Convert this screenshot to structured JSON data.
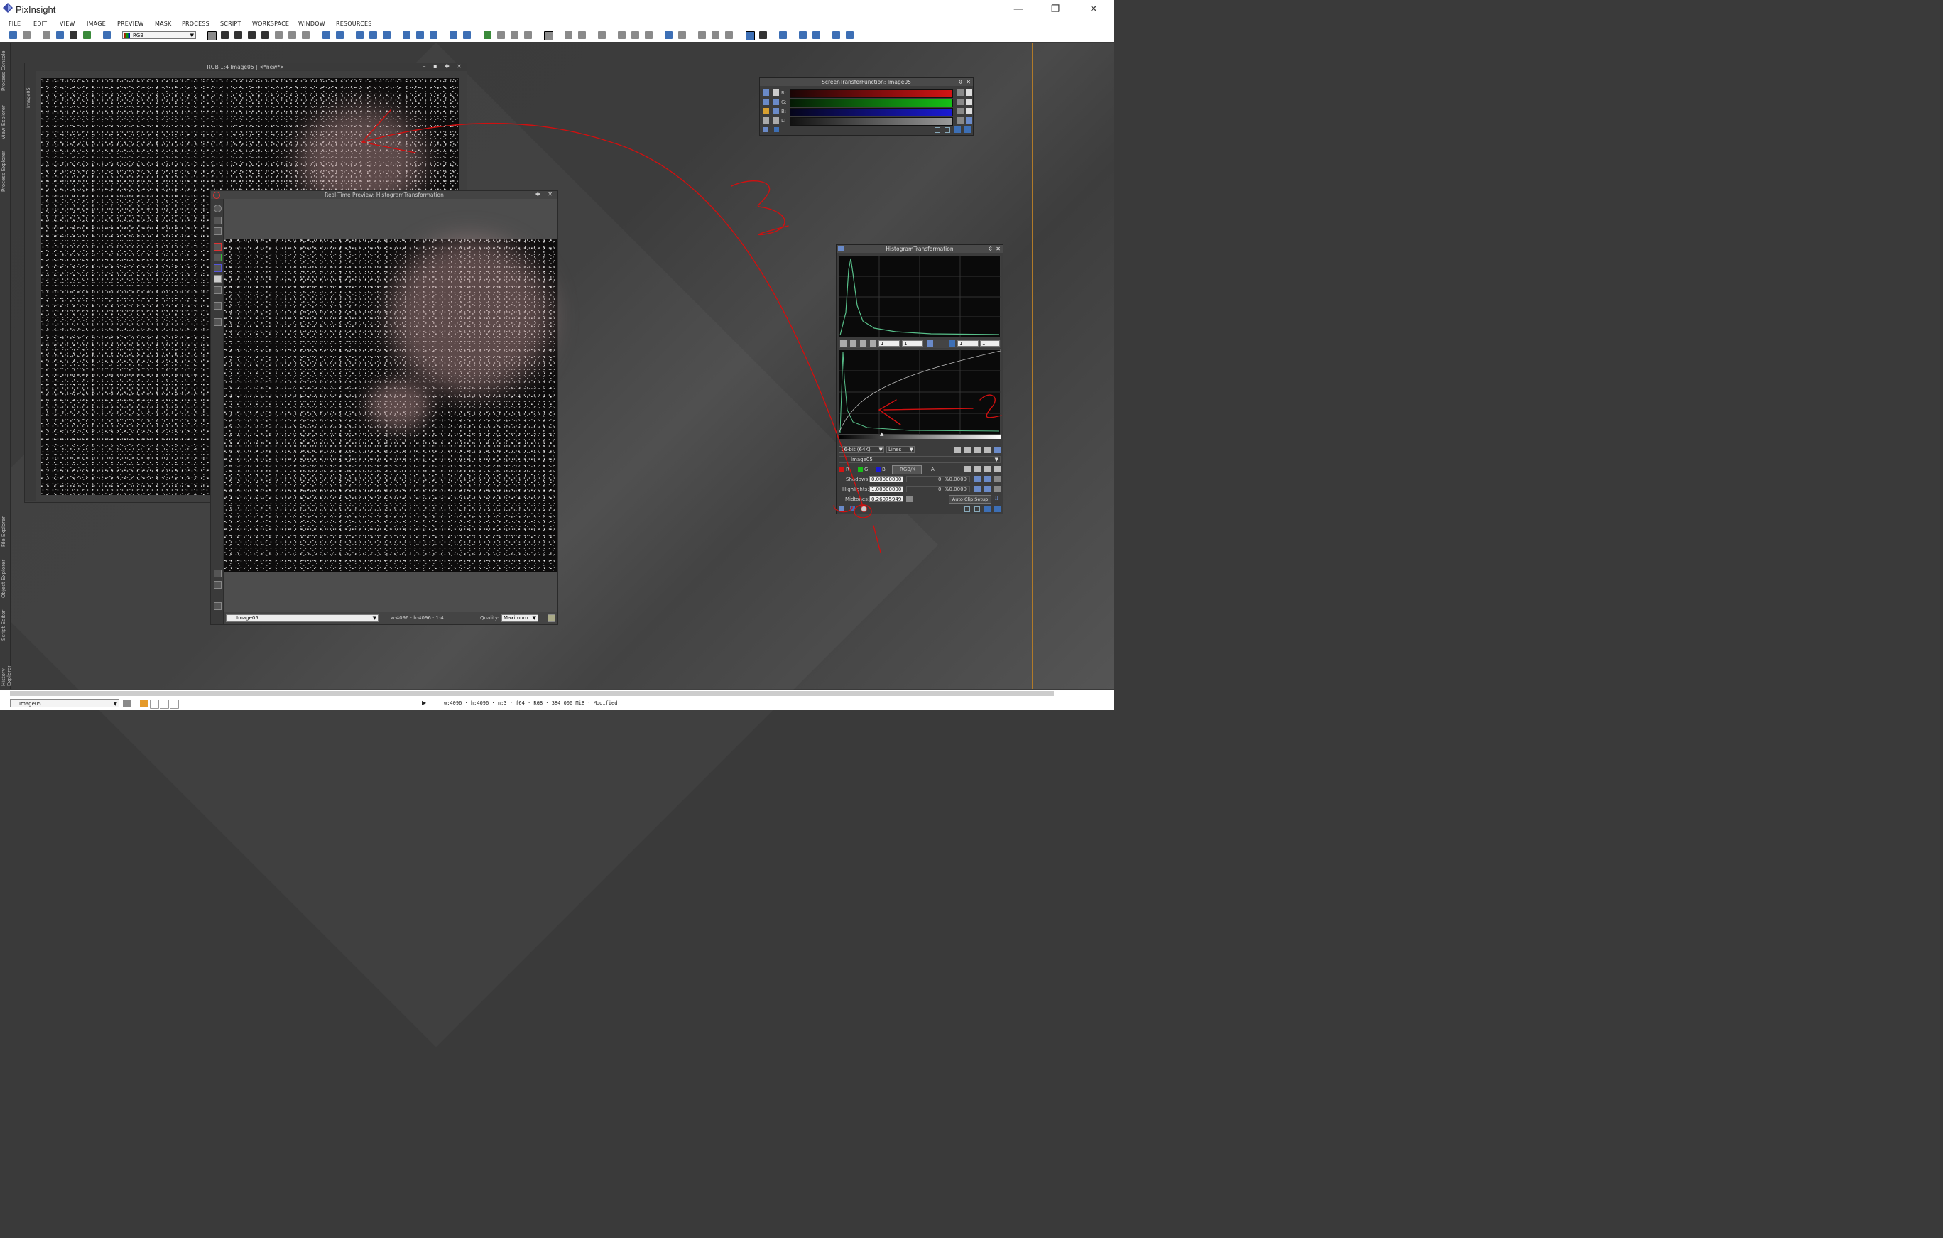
{
  "app": {
    "title": "PixInsight",
    "window_controls": [
      "—",
      "❐",
      "✕"
    ]
  },
  "menu": [
    "FILE",
    "EDIT",
    "VIEW",
    "IMAGE",
    "PREVIEW",
    "MASK",
    "PROCESS",
    "SCRIPT",
    "WORKSPACE",
    "WINDOW",
    "RESOURCES"
  ],
  "toolbar": {
    "color_space": "RGB"
  },
  "left_tabs": [
    "Process Console",
    "View Explorer",
    "Process Explorer",
    "File Explorer",
    "Object Explorer",
    "Script Editor",
    "History Explorer"
  ],
  "image_window": {
    "title": "RGB 1:4 Image05 | <*new*>",
    "side_label": "Image05"
  },
  "preview_window": {
    "title": "Real-Time Preview: HistogramTransformation",
    "view_select": "Image05",
    "dims": "w:4096 · h:4096 · 1:4",
    "quality_label": "Quality:",
    "quality_value": "Maximum"
  },
  "stf_panel": {
    "title": "ScreenTransferFunction: Image05",
    "channels": [
      {
        "label": "R:",
        "color": "#d41414"
      },
      {
        "label": "G:",
        "color": "#16c016"
      },
      {
        "label": "B:",
        "color": "#1a1ad4"
      },
      {
        "label": "L:",
        "color": "#9a9a9a"
      }
    ]
  },
  "ht_panel": {
    "title": "HistogramTransformation",
    "zoom_fields": [
      "1",
      "1",
      "1",
      "1"
    ],
    "bit_depth": "16-bit (64K)",
    "graph_style": "Lines",
    "view": "Image05",
    "channel_buttons": [
      "R",
      "G",
      "B",
      "RGB/K",
      "A"
    ],
    "shadows_label": "Shadows:",
    "shadows_value": "0.00000000",
    "shadows_clip": "0, %0.0000",
    "highlights_label": "Highlights:",
    "highlights_value": "1.00000000",
    "highlights_clip": "0, %0.0000",
    "midtones_label": "Midtones:",
    "midtones_value": "0.26075949",
    "auto_clip_label": "Auto Clip Setup"
  },
  "statusbar": {
    "view": "Image05",
    "info": "w:4096 · h:4096 · n:3 · f64 · RGB · 384.000 MiB · Modified"
  },
  "annotations": {
    "color": "#d01010",
    "numbers": [
      "1",
      "2",
      "3"
    ]
  }
}
